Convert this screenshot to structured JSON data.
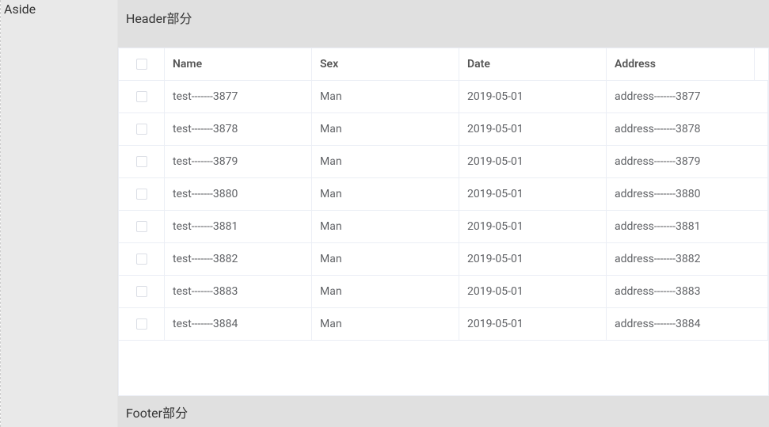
{
  "aside": {
    "title": "Aside"
  },
  "header": {
    "title": "Header部分"
  },
  "footer": {
    "title": "Footer部分"
  },
  "table": {
    "columns": {
      "name": "Name",
      "sex": "Sex",
      "date": "Date",
      "address": "Address"
    },
    "rows": [
      {
        "name": "test-------3877",
        "sex": "Man",
        "date": "2019-05-01",
        "address": "address-------3877"
      },
      {
        "name": "test-------3878",
        "sex": "Man",
        "date": "2019-05-01",
        "address": "address-------3878"
      },
      {
        "name": "test-------3879",
        "sex": "Man",
        "date": "2019-05-01",
        "address": "address-------3879"
      },
      {
        "name": "test-------3880",
        "sex": "Man",
        "date": "2019-05-01",
        "address": "address-------3880"
      },
      {
        "name": "test-------3881",
        "sex": "Man",
        "date": "2019-05-01",
        "address": "address-------3881"
      },
      {
        "name": "test-------3882",
        "sex": "Man",
        "date": "2019-05-01",
        "address": "address-------3882"
      },
      {
        "name": "test-------3883",
        "sex": "Man",
        "date": "2019-05-01",
        "address": "address-------3883"
      },
      {
        "name": "test-------3884",
        "sex": "Man",
        "date": "2019-05-01",
        "address": "address-------3884"
      }
    ]
  }
}
